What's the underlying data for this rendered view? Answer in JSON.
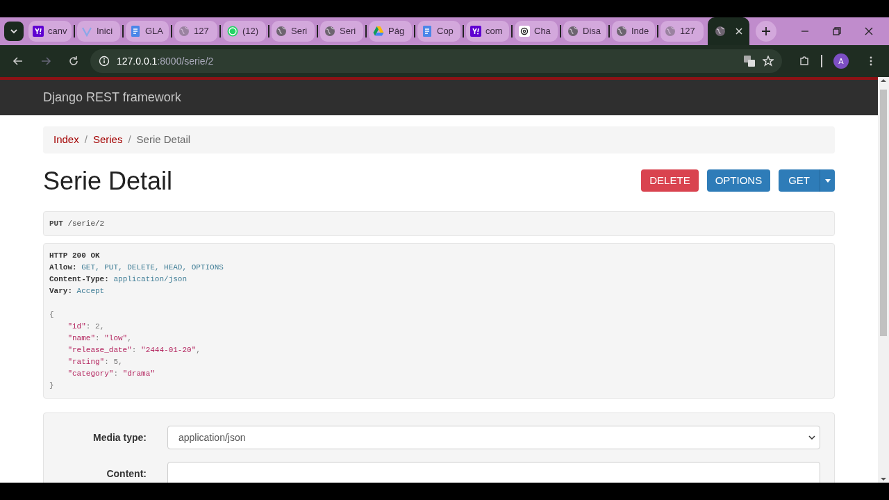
{
  "browser": {
    "tabs": [
      {
        "title": "canv",
        "kind": "yahoo",
        "selected": false
      },
      {
        "title": "Inici",
        "kind": "vee",
        "selected": false
      },
      {
        "title": "GLA",
        "kind": "doc",
        "selected": false
      },
      {
        "title": "127",
        "kind": "faded",
        "selected": false
      },
      {
        "title": "(12)",
        "kind": "whatsapp",
        "selected": false
      },
      {
        "title": "Seri",
        "kind": "globe",
        "selected": false
      },
      {
        "title": "Seri",
        "kind": "globe",
        "selected": false
      },
      {
        "title": "Pág",
        "kind": "drive",
        "selected": false
      },
      {
        "title": "Cop",
        "kind": "doc",
        "selected": false
      },
      {
        "title": "com",
        "kind": "yahoo",
        "selected": false
      },
      {
        "title": "Cha",
        "kind": "chat",
        "selected": false
      },
      {
        "title": "Disa",
        "kind": "globe",
        "selected": false
      },
      {
        "title": "Inde",
        "kind": "globe",
        "selected": false
      },
      {
        "title": "127",
        "kind": "faded",
        "selected": false
      },
      {
        "kind": "globe",
        "selected": true
      }
    ],
    "url_host": "127.0.0.1",
    "url_path": ":8000/serie/2",
    "avatar": "A"
  },
  "navbar": {
    "brand": "Django REST framework"
  },
  "breadcrumbs": [
    {
      "label": "Index",
      "active": false
    },
    {
      "separator": "/",
      "label": "Series",
      "active": false
    },
    {
      "separator": "/",
      "label": "Serie Detail",
      "active": true
    }
  ],
  "heading": "Serie Detail",
  "actions": [
    {
      "label": "DELETE",
      "kind": "danger"
    },
    {
      "label": "OPTIONS",
      "kind": "primary"
    },
    {
      "label": "GET",
      "kind": "split"
    }
  ],
  "request": {
    "method": "PUT",
    "path": "/serie/2"
  },
  "response": {
    "status": "HTTP 200 OK",
    "headers": [
      {
        "name": "Allow:",
        "value": "GET, PUT, DELETE, HEAD, OPTIONS"
      },
      {
        "name": "Content-Type:",
        "value": "application/json"
      },
      {
        "name": "Vary:",
        "value": "Accept"
      }
    ],
    "open": "{",
    "close": "}",
    "fields": [
      {
        "key": "\"id\"",
        "sep": ":",
        "value": "2",
        "kind": "number",
        "end": ","
      },
      {
        "key": "\"name\"",
        "sep": ":",
        "value": "\"low\"",
        "kind": "string",
        "end": ","
      },
      {
        "key": "\"release_date\"",
        "sep": ":",
        "value": "\"2444-01-20\"",
        "kind": "string",
        "end": ","
      },
      {
        "key": "\"rating\"",
        "sep": ":",
        "value": "5",
        "kind": "number",
        "end": ","
      },
      {
        "key": "\"category\"",
        "sep": ":",
        "value": "\"drama\"",
        "kind": "string"
      }
    ]
  },
  "form": {
    "media_label": "Media type:",
    "media_value": "application/json",
    "content_label": "Content:"
  }
}
